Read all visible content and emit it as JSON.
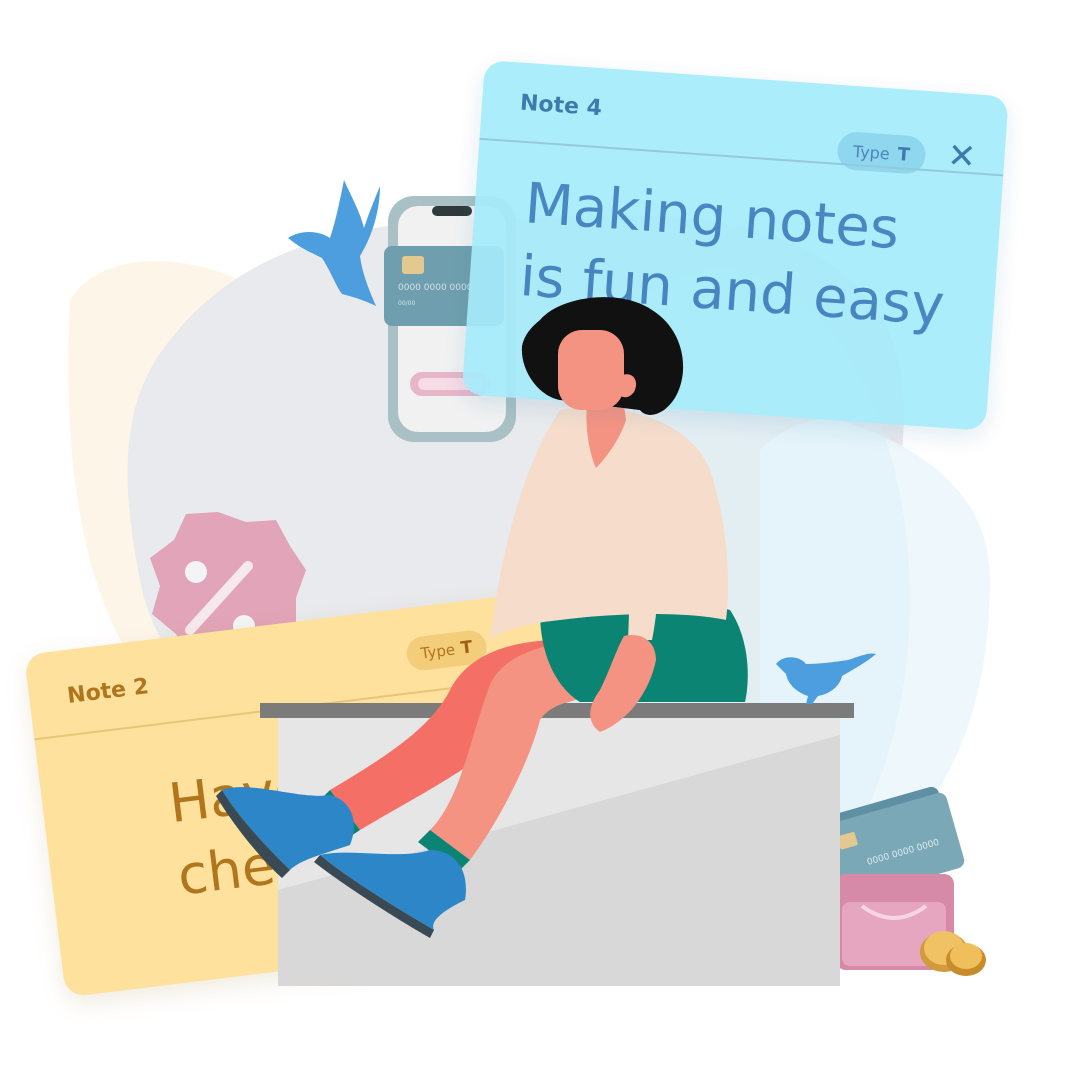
{
  "notes": {
    "note4": {
      "title": "Note 4",
      "type_label": "Type",
      "type_icon": "T",
      "close_icon": "✕",
      "text": "Making notes\nis fun and easy"
    },
    "note2": {
      "title": "Note 2",
      "type_label": "Type",
      "type_icon": "T",
      "text": "Have\nchec"
    }
  },
  "phone_card": {
    "card_number": "0000 0000 0000",
    "card_expiry": "00/00"
  },
  "wallet_card": {
    "card_number": "0000 0000 0000"
  },
  "colors": {
    "note4_bg": "#a6ecfb",
    "note2_bg": "#fde19d",
    "bird": "#4d9ede",
    "shirt": "#f5dccb",
    "shorts": "#0b8473",
    "shoes": "#2c86c8",
    "skin": "#f59383",
    "hair": "#111111"
  }
}
